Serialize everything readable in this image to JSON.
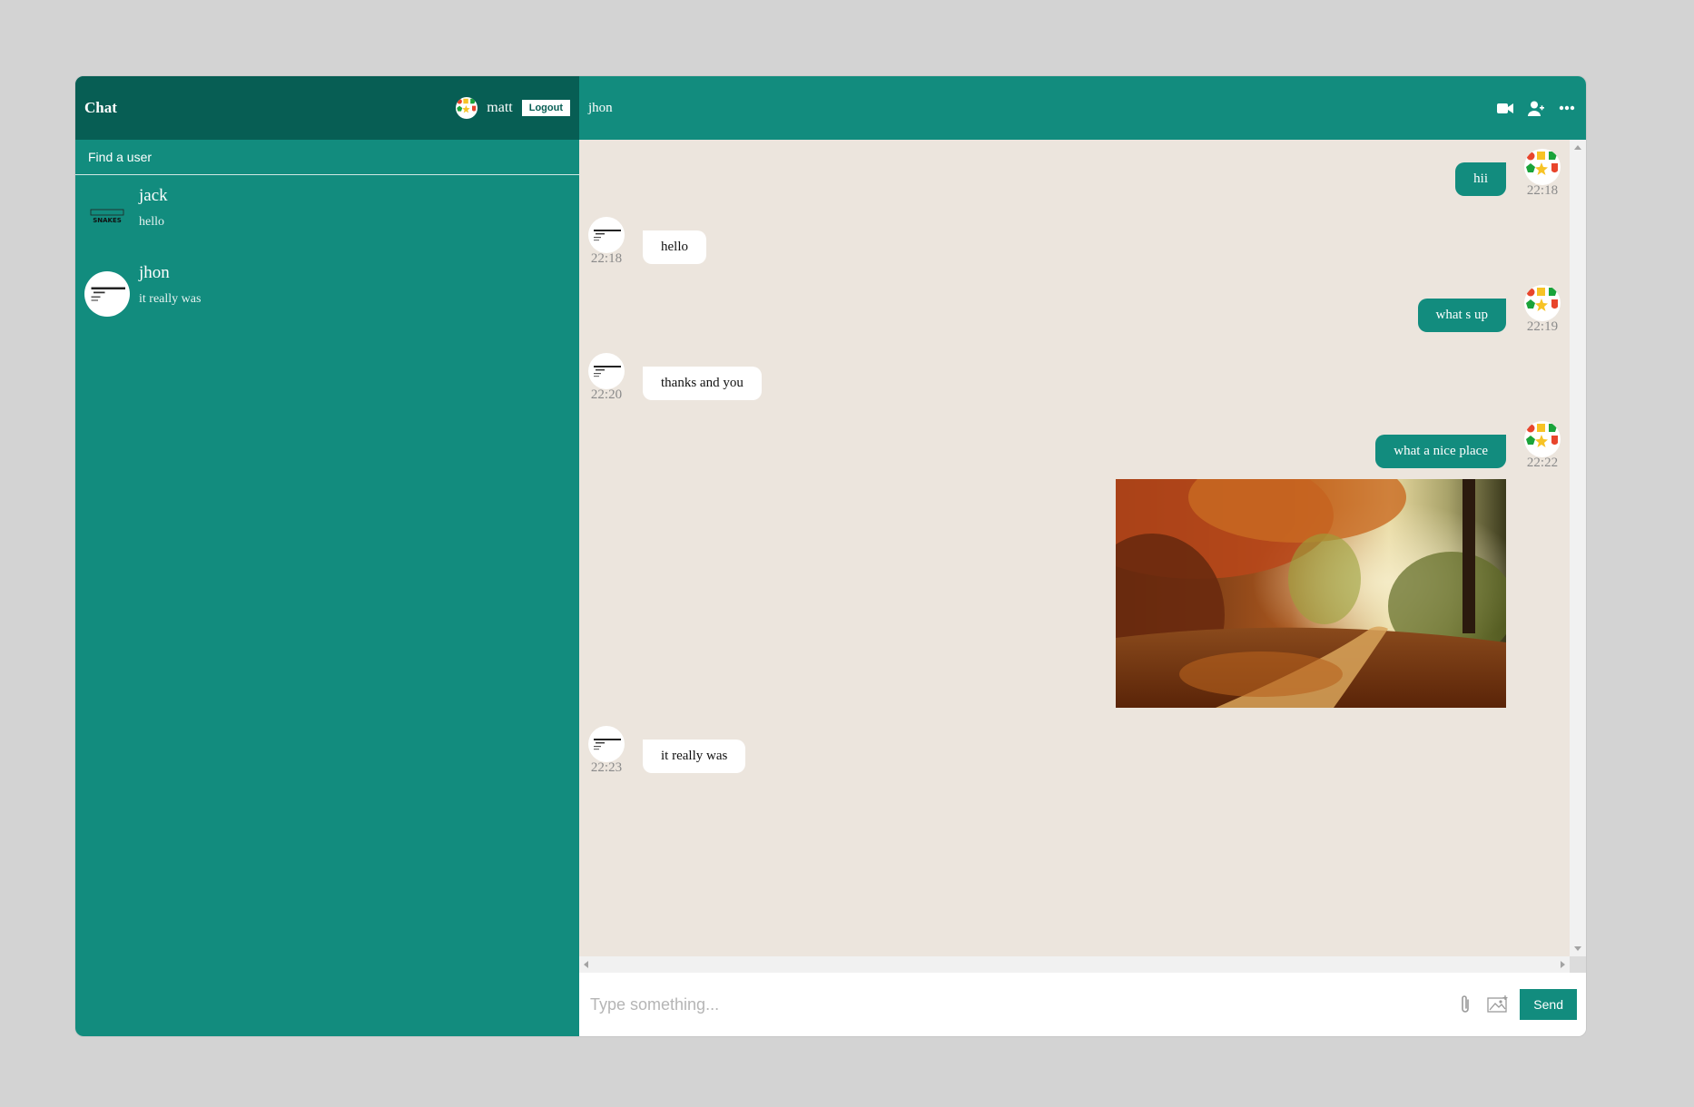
{
  "sidebar": {
    "brand": "Chat",
    "current_user": {
      "name": "matt",
      "avatar_icon": "colorful-shapes-avatar"
    },
    "logout_label": "Logout",
    "search_placeholder": "Find a user",
    "chats": [
      {
        "name": "jack",
        "last_message": "hello",
        "avatar_text": "SNAKES"
      },
      {
        "name": "jhon",
        "last_message": "it really was"
      }
    ]
  },
  "chat": {
    "title": "jhon",
    "header_icons": [
      "video-camera-icon",
      "add-user-icon",
      "more-options-icon"
    ],
    "messages": [
      {
        "owner": true,
        "text": "hii",
        "time": "22:18"
      },
      {
        "owner": false,
        "text": "hello",
        "time": "22:18"
      },
      {
        "owner": true,
        "text": "what s up",
        "time": "22:19"
      },
      {
        "owner": false,
        "text": "thanks and you",
        "time": "22:20"
      },
      {
        "owner": true,
        "text": "what a nice place",
        "time": "22:22",
        "image": "autumn-forest-path-photo"
      },
      {
        "owner": false,
        "text": "it really was",
        "time": "22:23"
      }
    ]
  },
  "input": {
    "placeholder": "Type something...",
    "value": "",
    "attach_icon": "paperclip-icon",
    "image_icon": "image-icon",
    "send_label": "Send"
  },
  "colors": {
    "primary": "#128c7e",
    "dark": "#075e54",
    "chat_bg": "#ece5dd"
  }
}
